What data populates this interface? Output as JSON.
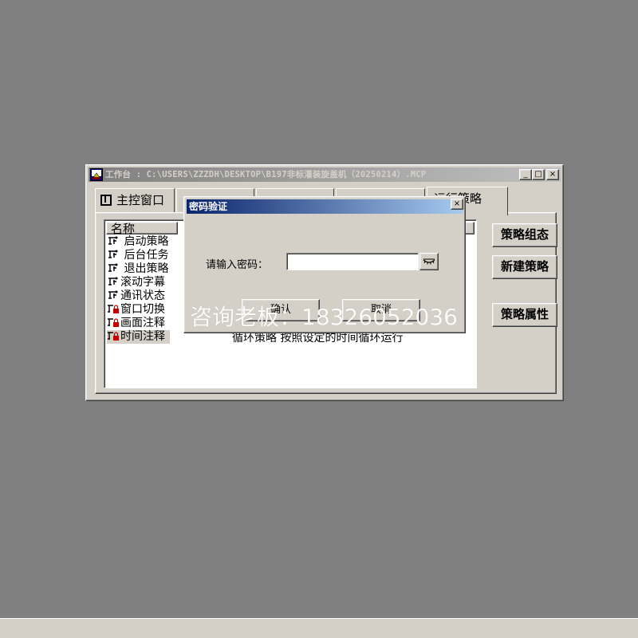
{
  "window": {
    "title": "工作台 : C:\\USERS\\ZZZDH\\DESKTOP\\B197非标灌装旋盖机（20250214）.MCP",
    "minimize": "_",
    "maximize": "□",
    "close": "×"
  },
  "tabs": [
    {
      "label": "主控窗口",
      "active": false
    },
    {
      "label": "",
      "active": false
    },
    {
      "label": "",
      "active": false
    },
    {
      "label": "",
      "active": false
    },
    {
      "label": "运行策略",
      "active": true
    }
  ],
  "policy_list": {
    "column_header": "名称",
    "items": [
      {
        "label": " 启动策略",
        "icon": "policy-icon"
      },
      {
        "label": " 后台任务",
        "icon": "policy-icon"
      },
      {
        "label": " 退出策略",
        "icon": "policy-icon"
      },
      {
        "label": "滚动字幕",
        "icon": "policy-icon"
      },
      {
        "label": "通讯状态",
        "icon": "policy-icon"
      },
      {
        "label": "窗口切换",
        "icon": "locked-policy-icon"
      },
      {
        "label": "画面注释",
        "icon": "locked-policy-icon"
      },
      {
        "label": "时间注释",
        "icon": "locked-policy-icon"
      }
    ],
    "selected_row": "时间注释",
    "visible_description": "循环策略    按照设定的时间循环运行"
  },
  "side_buttons": {
    "component": "策略组态",
    "new": "新建策略",
    "properties": "策略属性"
  },
  "dialog": {
    "title": "密码验证",
    "close": "×",
    "prompt": "请输入密码：",
    "password_value": "",
    "ok_label": "确认",
    "cancel_label": "取消"
  },
  "watermark": "咨询老板：18326052036",
  "colors": {
    "desktop": "#808080",
    "face": "#d4d0c8",
    "dialog_title_start": "#0a246a",
    "dialog_title_end": "#a6caf0",
    "inactive_title_start": "#808080",
    "inactive_title_end": "#c0c0c0"
  }
}
